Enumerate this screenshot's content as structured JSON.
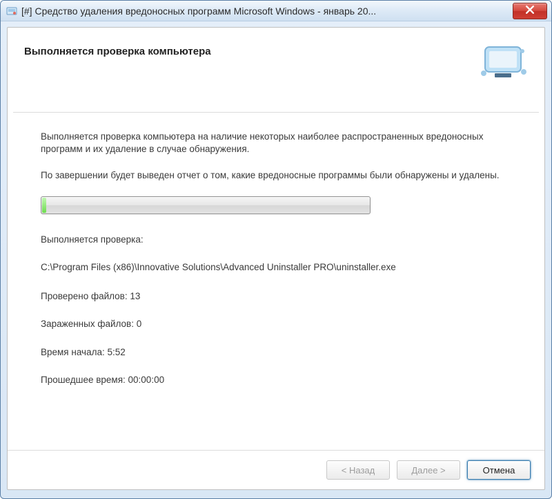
{
  "window": {
    "title": "[#] Средство удаления вредоносных программ Microsoft Windows -  январь 20..."
  },
  "header": {
    "title": "Выполняется проверка компьютера"
  },
  "body": {
    "para1": "Выполняется проверка компьютера на наличие некоторых наиболее распространенных вредоносных программ и их удаление в случае обнаружения.",
    "para2": "По завершении будет выведен отчет о том, какие вредоносные программы были обнаружены и удалены."
  },
  "status": {
    "doing_label": "Выполняется проверка:",
    "current_path": "C:\\Program Files (x86)\\Innovative Solutions\\Advanced Uninstaller PRO\\uninstaller.exe",
    "scanned_label": "Проверено файлов:",
    "scanned_value": "13",
    "infected_label": "Зараженных файлов:",
    "infected_value": "0",
    "start_label": "Время начала:",
    "start_value": "5:52",
    "elapsed_label": "Прошедшее время:",
    "elapsed_value": "00:00:00"
  },
  "footer": {
    "back": "< Назад",
    "next": "Далее >",
    "cancel": "Отмена"
  },
  "progress": {
    "percent": 1
  }
}
